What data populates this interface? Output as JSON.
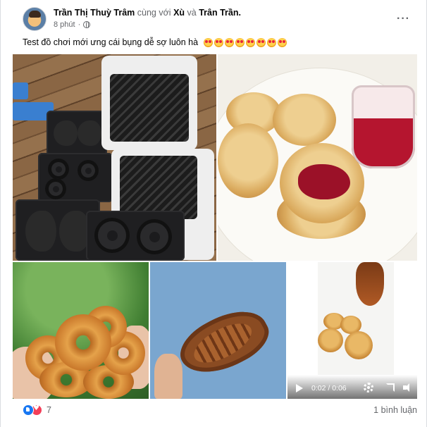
{
  "post": {
    "author": "Trần Thị Thuỳ Trâm",
    "with_text": "cùng với",
    "tag1": "Xù",
    "and_text": "và",
    "tag2": "Trân Trần.",
    "time": "8 phút",
    "privacy_icon": "globe-icon",
    "more_icon": "more-options-icon",
    "more_glyph": "···",
    "caption": "Test đồ chơi mới ưng cái bụng dễ sợ luôn hà"
  },
  "photos": [
    {
      "subject": "waffle-maker-plates"
    },
    {
      "subject": "pancakes-with-jam"
    },
    {
      "subject": "donuts"
    },
    {
      "subject": "fish-shaped-cake"
    },
    {
      "subject": "video-pancakes-syrup"
    }
  ],
  "video": {
    "time": "0:02 / 0:06"
  },
  "footer": {
    "reaction_count": "7",
    "comments": "1 bình luận",
    "reaction_icons": [
      "like-icon",
      "love-icon"
    ]
  },
  "colors": {
    "brand_blue": "#1877f2",
    "love_red": "#f33e58",
    "secondary_text": "#65676b"
  }
}
